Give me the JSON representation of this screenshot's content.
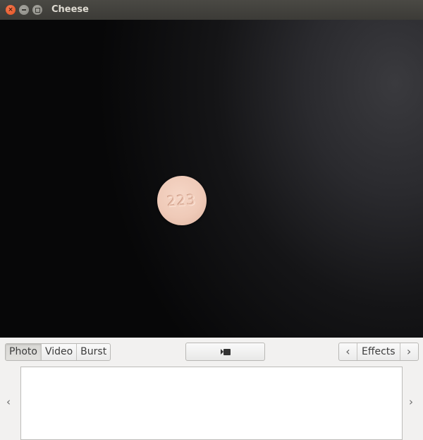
{
  "window": {
    "title": "Cheese",
    "close_glyph": "×"
  },
  "viewport": {
    "pill_imprint": "223"
  },
  "toolbar": {
    "modes": [
      {
        "label": "Photo",
        "active": true
      },
      {
        "label": "Video",
        "active": false
      },
      {
        "label": "Burst",
        "active": false
      }
    ],
    "shutter_icon": "video-record-icon",
    "effects_label": "Effects",
    "effects_prev_glyph": "‹",
    "effects_next_glyph": "›"
  },
  "thumbnail_strip": {
    "prev_glyph": "‹",
    "next_glyph": "›"
  }
}
